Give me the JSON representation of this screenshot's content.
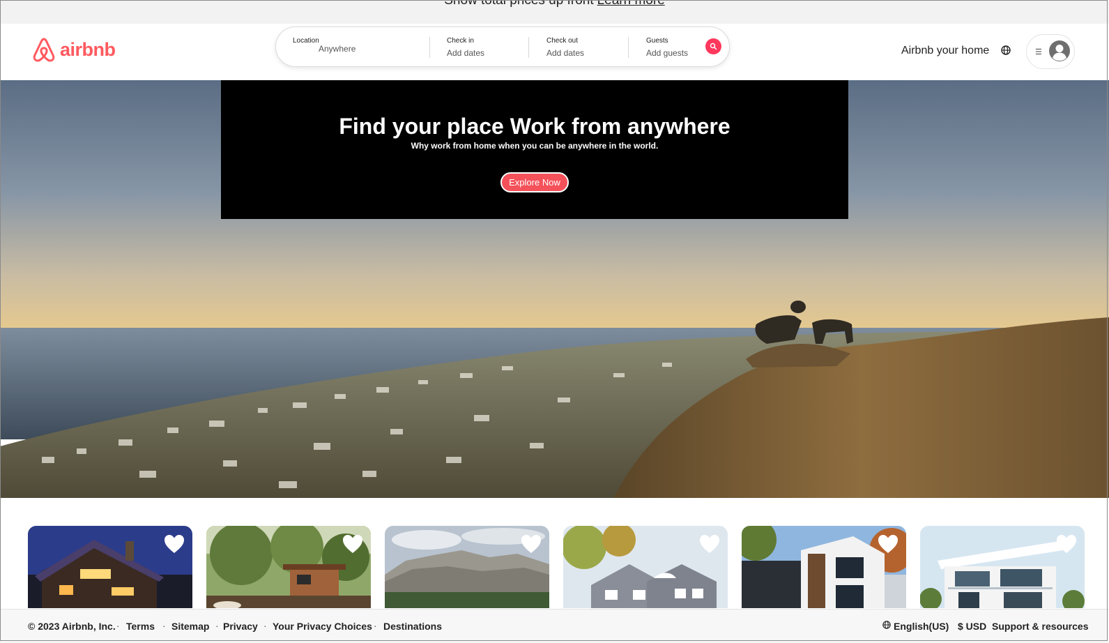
{
  "banner": {
    "text": "Show total prices up front",
    "link": "Learn more"
  },
  "header": {
    "brand": "airbnb",
    "search": {
      "location_label": "Location",
      "location_value": "Anywhere",
      "checkin_label": "Check in",
      "checkin_value": "Add dates",
      "checkout_label": "Check out",
      "checkout_value": "Add dates",
      "guests_label": "Guests",
      "guests_value": "Add guests"
    },
    "host_link": "Airbnb your home"
  },
  "hero": {
    "title": "Find your place Work from anywhere",
    "subtitle": "Why work from home when you can be anywhere in the world.",
    "cta": "Explore Now"
  },
  "listings": [
    {
      "scene": "cabin-at-dusk"
    },
    {
      "scene": "treehouse-in-forest"
    },
    {
      "scene": "rocky-mountain-ridge"
    },
    {
      "scene": "gray-shingled-house"
    },
    {
      "scene": "modern-dark-house"
    },
    {
      "scene": "white-modern-villa"
    }
  ],
  "footer": {
    "copyright": "© 2023 Airbnb, Inc.",
    "links": [
      "Terms",
      "Sitemap",
      "Privacy",
      "Your Privacy Choices",
      "Destinations"
    ],
    "separator": "·",
    "language": "English(US)",
    "currency": "$ USD",
    "support": "Support & resources"
  },
  "colors": {
    "brand": "#ff5a5f",
    "search_button": "#ff385c",
    "cta": "#f4515a",
    "hero_panel": "#000000"
  }
}
